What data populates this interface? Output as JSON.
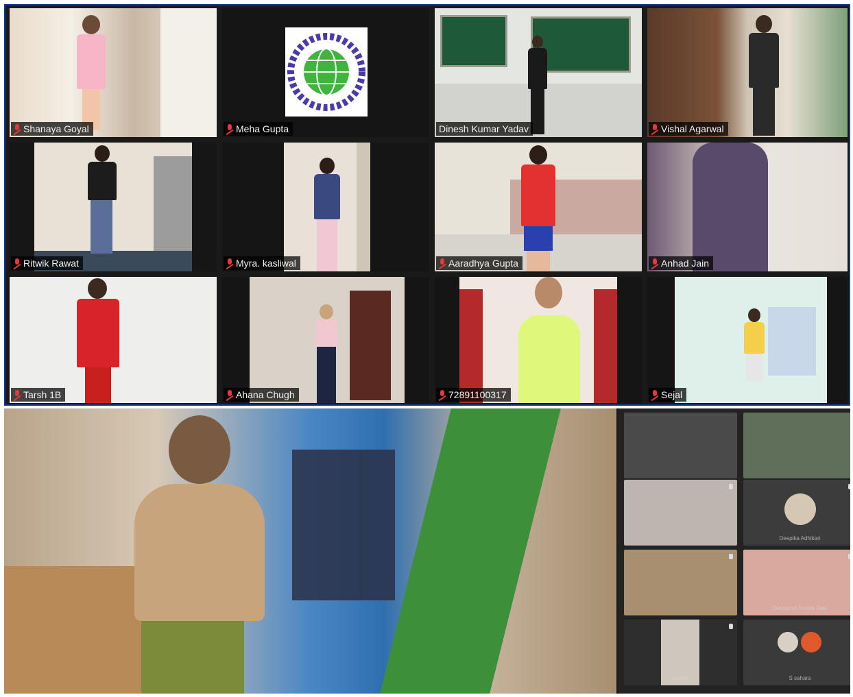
{
  "gallery": {
    "participants": [
      {
        "name": "Shanaya Goyal",
        "muted": true
      },
      {
        "name": "Meha Gupta",
        "muted": true
      },
      {
        "name": "Dinesh Kumar Yadav",
        "muted": false,
        "active_speaker": true
      },
      {
        "name": "Vishal Agarwal",
        "muted": true
      },
      {
        "name": "Ritwik Rawat",
        "muted": true
      },
      {
        "name": "Myra. kasliwal",
        "muted": true
      },
      {
        "name": "Aaradhya Gupta",
        "muted": true
      },
      {
        "name": "Anhad Jain",
        "muted": true
      },
      {
        "name": "Tarsh 1B",
        "muted": true
      },
      {
        "name": "Ahana Chugh",
        "muted": true
      },
      {
        "name": "72891100317",
        "muted": true
      },
      {
        "name": "Sejal",
        "muted": true
      }
    ],
    "icons": {
      "muted": "mic-muted-icon"
    },
    "colors": {
      "active_border": "#cfe86b",
      "mute": "#e03a3a"
    }
  },
  "meet": {
    "thumbnails": [
      {
        "label": ""
      },
      {
        "label": ""
      },
      {
        "label": ""
      },
      {
        "label": "Deepika Adhikari"
      },
      {
        "label": ""
      },
      {
        "label": "Devyansh Kumar Rao"
      },
      {
        "label": "khushi"
      },
      {
        "label": "S sahara"
      }
    ]
  }
}
